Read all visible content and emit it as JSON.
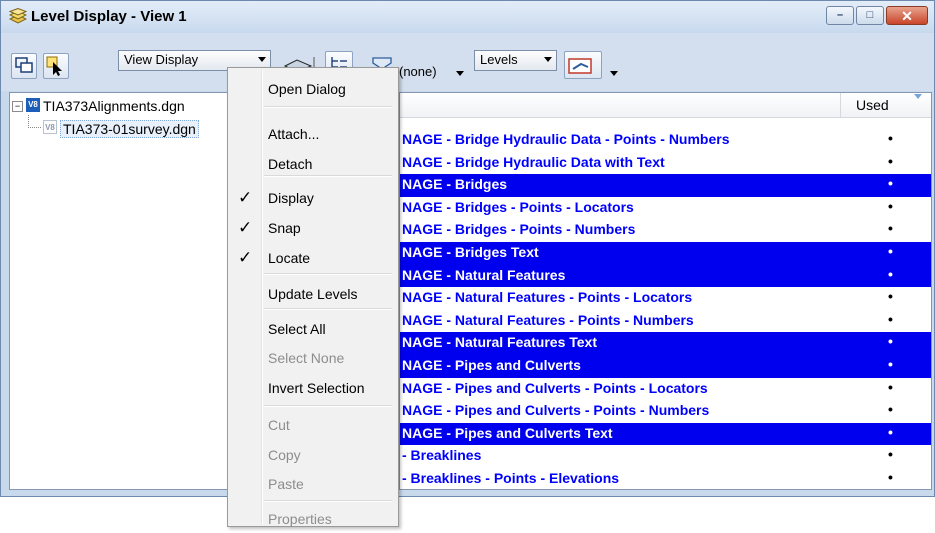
{
  "window": {
    "title": "Level Display - View 1",
    "caption_minimize": "–",
    "caption_restore": "□",
    "caption_close": "✕"
  },
  "toolbar": {
    "view_display_combo": "View Display",
    "filter_combo": "(none)",
    "levels_combo": "Levels"
  },
  "tree": {
    "root": "TIA373Alignments.dgn",
    "child": "TIA373-01survey.dgn",
    "root_icon_text": "V8",
    "child_icon_text": "V8"
  },
  "list": {
    "used_header": "Used",
    "rows": [
      {
        "name": "NAGE - Bridge Hydraulic Data - Points - Numbers",
        "used": "•",
        "selected": false
      },
      {
        "name": "NAGE - Bridge Hydraulic Data with Text",
        "used": "•",
        "selected": false
      },
      {
        "name": "NAGE - Bridges",
        "used": "•",
        "selected": true
      },
      {
        "name": "NAGE - Bridges - Points - Locators",
        "used": "•",
        "selected": false
      },
      {
        "name": "NAGE - Bridges - Points - Numbers",
        "used": "•",
        "selected": false
      },
      {
        "name": "NAGE - Bridges Text",
        "used": "•",
        "selected": true
      },
      {
        "name": "NAGE - Natural Features",
        "used": "•",
        "selected": true
      },
      {
        "name": "NAGE - Natural Features - Points - Locators",
        "used": "•",
        "selected": false
      },
      {
        "name": "NAGE - Natural Features - Points - Numbers",
        "used": "•",
        "selected": false
      },
      {
        "name": "NAGE - Natural Features Text",
        "used": "•",
        "selected": true
      },
      {
        "name": "NAGE - Pipes and Culverts",
        "used": "•",
        "selected": true
      },
      {
        "name": "NAGE - Pipes and Culverts - Points - Locators",
        "used": "•",
        "selected": false
      },
      {
        "name": "NAGE - Pipes and Culverts - Points - Numbers",
        "used": "•",
        "selected": false
      },
      {
        "name": "NAGE - Pipes and Culverts Text",
        "used": "•",
        "selected": true
      },
      {
        "name": "- Breaklines",
        "used": "•",
        "selected": false
      },
      {
        "name": "- Breaklines - Points - Elevations",
        "used": "•",
        "selected": false
      }
    ]
  },
  "context_menu": {
    "items": [
      {
        "label": "Open Dialog",
        "checked": false,
        "disabled": false
      },
      {
        "label": "Attach...",
        "checked": false,
        "disabled": false
      },
      {
        "label": "Detach",
        "checked": false,
        "disabled": false
      },
      {
        "label": "Display",
        "checked": true,
        "disabled": false
      },
      {
        "label": "Snap",
        "checked": true,
        "disabled": false
      },
      {
        "label": "Locate",
        "checked": true,
        "disabled": false
      },
      {
        "label": "Update Levels",
        "checked": false,
        "disabled": false
      },
      {
        "label": "Select All",
        "checked": false,
        "disabled": false
      },
      {
        "label": "Select None",
        "checked": false,
        "disabled": true
      },
      {
        "label": "Invert Selection",
        "checked": false,
        "disabled": false
      },
      {
        "label": "Cut",
        "checked": false,
        "disabled": true
      },
      {
        "label": "Copy",
        "checked": false,
        "disabled": true
      },
      {
        "label": "Paste",
        "checked": false,
        "disabled": true
      },
      {
        "label": "Properties",
        "checked": false,
        "disabled": true
      }
    ],
    "check_glyph": "✓"
  },
  "colors": {
    "selected_row_bg": "#0000ee",
    "level_text": "#0000ff"
  }
}
